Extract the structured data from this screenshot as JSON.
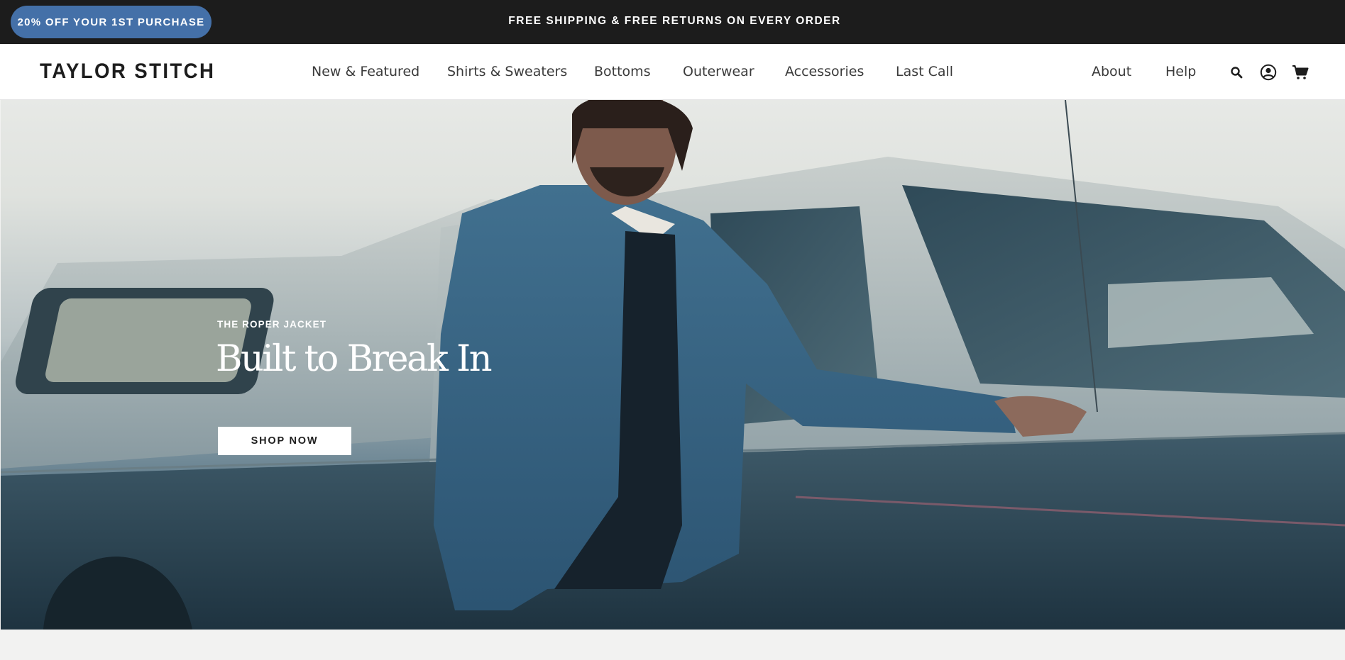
{
  "announcement": {
    "promo_label": "20% OFF YOUR 1ST PURCHASE",
    "message": "FREE SHIPPING & FREE RETURNS ON EVERY ORDER",
    "promo_color": "#4470a8",
    "bar_color": "#1c1c1c"
  },
  "header": {
    "logo": "TAYLOR STITCH",
    "nav": [
      "New & Featured",
      "Shirts & Sweaters",
      "Bottoms",
      "Outerwear",
      "Accessories",
      "Last Call"
    ],
    "secondary": [
      "About",
      "Help"
    ],
    "icons": [
      "search-icon",
      "account-icon",
      "cart-icon"
    ]
  },
  "hero": {
    "eyebrow": "THE ROPER JACKET",
    "title": "Built to Break In",
    "cta_label": "SHOP NOW"
  }
}
